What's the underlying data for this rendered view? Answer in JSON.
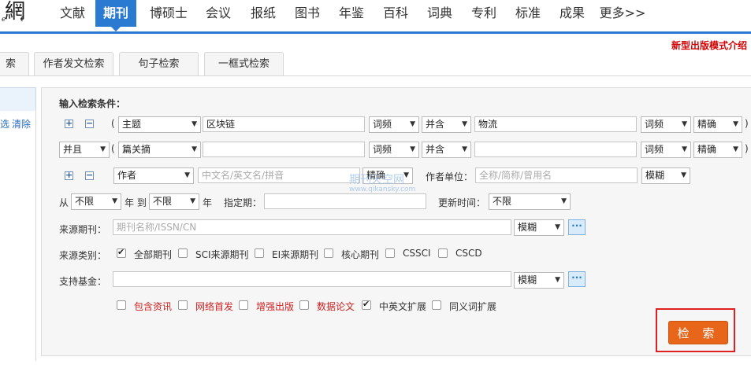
{
  "logo": {
    "glyph": "網",
    "sub": "e t"
  },
  "nav": {
    "items": [
      "文献",
      "期刊",
      "博硕士",
      "会议",
      "报纸",
      "图书",
      "年鉴",
      "百科",
      "词典",
      "专利",
      "标准",
      "成果",
      "更多>>"
    ],
    "promo": "新型出版模式介绍"
  },
  "tabs": [
    "索",
    "作者发文检索",
    "句子检索",
    "一框式检索"
  ],
  "sidebar": {
    "filter": "选",
    "clear": "清除"
  },
  "form": {
    "title": "输入检索条件：",
    "row1": {
      "paren_open": "(",
      "field": "主题",
      "value": "区块链",
      "freq": "词频",
      "op": "并含",
      "value2": "物流",
      "freq2": "词频",
      "match": "精确",
      "paren_close": ")"
    },
    "row2": {
      "logic": "并且",
      "paren_open": "(",
      "field": "篇关摘",
      "value": "",
      "freq": "词频",
      "op": "并含",
      "value2": "",
      "freq2": "词频",
      "match": "精确",
      "paren_close": ")"
    },
    "author": {
      "field": "作者",
      "placeholder": "中文名/英文名/拼音",
      "match": "精确",
      "unit_label": "作者单位：",
      "unit_placeholder": "全称/简称/曾用名",
      "unit_match": "模糊"
    },
    "time": {
      "from_label": "从",
      "from": "不限",
      "year_to": "年 到",
      "to": "不限",
      "year": "年",
      "specified_label": "指定期：",
      "updated_label": "更新时间：",
      "updated": "不限"
    },
    "source": {
      "label": "来源期刊：",
      "placeholder": "期刊名称/ISSN/CN",
      "match": "模糊",
      "more": "···"
    },
    "category": {
      "label": "来源类别：",
      "options": [
        "全部期刊",
        "SCI来源期刊",
        "EI来源期刊",
        "核心期刊",
        "CSSCI",
        "CSCD"
      ],
      "checked": [
        true,
        false,
        false,
        false,
        false,
        false
      ]
    },
    "fund": {
      "label": "支持基金：",
      "match": "模糊",
      "more": "···"
    },
    "extras": {
      "options": [
        "包含资讯",
        "网络首发",
        "增强出版",
        "数据论文",
        "中英文扩展",
        "同义词扩展"
      ],
      "checked": [
        false,
        false,
        false,
        false,
        true,
        false
      ]
    },
    "search_button": "检 索"
  },
  "watermark": {
    "line1": "期刊天空网",
    "line2": "www.qikansky.com"
  },
  "colors": {
    "accent": "#2a7ad2",
    "button": "#e8661a",
    "highlight": "#e02020",
    "red_text": "#cc2222"
  }
}
